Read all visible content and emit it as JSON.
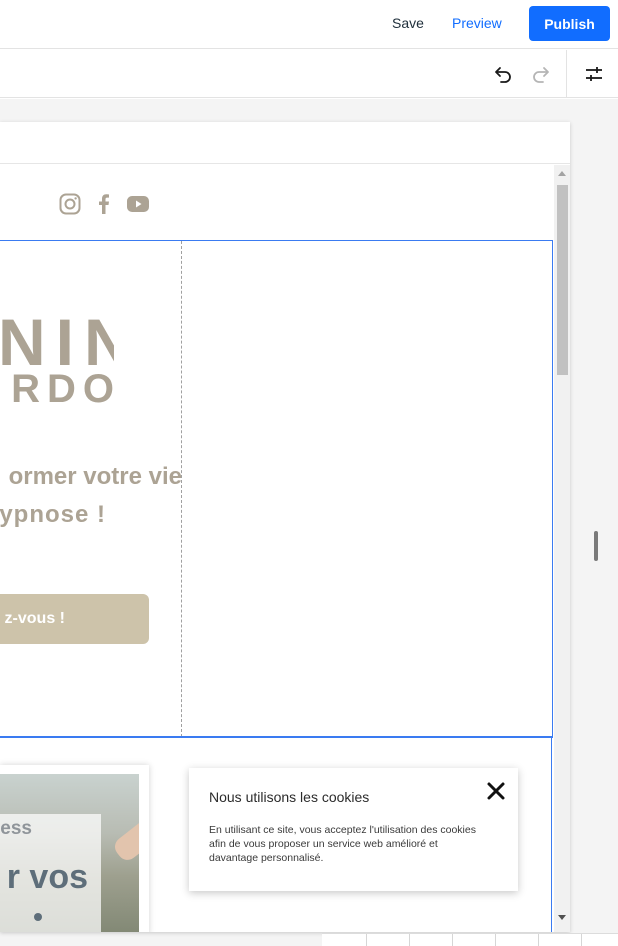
{
  "topbar": {
    "save_label": "Save",
    "preview_label": "Preview",
    "publish_label": "Publish",
    "accent_color": "#116dff"
  },
  "toolbar": {
    "undo_icon": "undo-icon",
    "redo_icon": "redo-icon",
    "settings_icon": "sliders-icon"
  },
  "site": {
    "social_icons": [
      "instagram-icon",
      "facebook-icon",
      "youtube-icon"
    ],
    "logo_line1": "NINE",
    "logo_line2": "RDO",
    "tagline_line1": "ormer votre vie",
    "tagline_line2": "ypnose !",
    "cta_label": "z-vous !",
    "brand_color": "#aca394",
    "cta_color": "#cdc3aa",
    "card_tag": "ess",
    "card_heading": "r vos"
  },
  "cookie_banner": {
    "title": "Nous utilisons les cookies",
    "body": "En utilisant ce site, vous acceptez l'utilisation des cookies afin de vous proposer un service web amélioré et davantage personnalisé."
  }
}
